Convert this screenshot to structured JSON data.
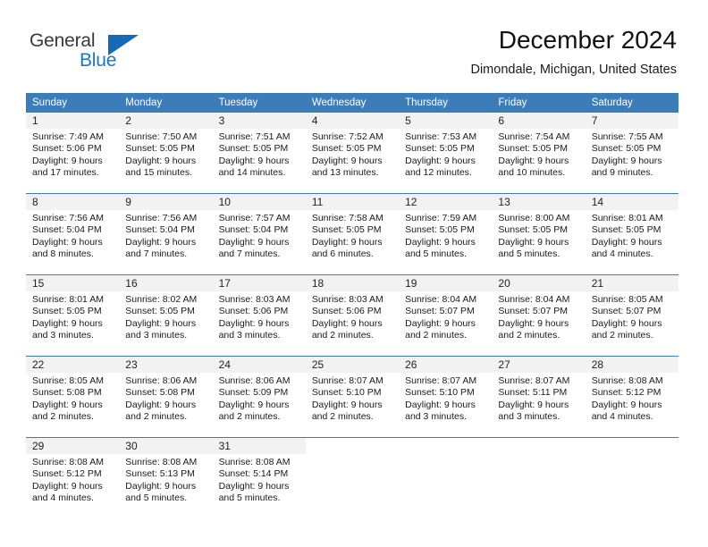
{
  "logo": {
    "primary_text": "General",
    "secondary_text": "Blue",
    "primary_color": "#3a3a3a",
    "secondary_color": "#1878c8",
    "accent_color": "#1669b5"
  },
  "header": {
    "title": "December 2024",
    "subtitle": "Dimondale, Michigan, United States"
  },
  "theme": {
    "header_row_bg": "#3c7cb9",
    "header_row_text": "#ffffff",
    "day_number_bg": "#f2f2f2",
    "week_divider": "#3c7cb9",
    "page_bg": "#ffffff"
  },
  "weekday_headers": [
    "Sunday",
    "Monday",
    "Tuesday",
    "Wednesday",
    "Thursday",
    "Friday",
    "Saturday"
  ],
  "weeks": [
    [
      {
        "day": "1",
        "sunrise": "Sunrise: 7:49 AM",
        "sunset": "Sunset: 5:06 PM",
        "daylight_line1": "Daylight: 9 hours",
        "daylight_line2": "and 17 minutes."
      },
      {
        "day": "2",
        "sunrise": "Sunrise: 7:50 AM",
        "sunset": "Sunset: 5:05 PM",
        "daylight_line1": "Daylight: 9 hours",
        "daylight_line2": "and 15 minutes."
      },
      {
        "day": "3",
        "sunrise": "Sunrise: 7:51 AM",
        "sunset": "Sunset: 5:05 PM",
        "daylight_line1": "Daylight: 9 hours",
        "daylight_line2": "and 14 minutes."
      },
      {
        "day": "4",
        "sunrise": "Sunrise: 7:52 AM",
        "sunset": "Sunset: 5:05 PM",
        "daylight_line1": "Daylight: 9 hours",
        "daylight_line2": "and 13 minutes."
      },
      {
        "day": "5",
        "sunrise": "Sunrise: 7:53 AM",
        "sunset": "Sunset: 5:05 PM",
        "daylight_line1": "Daylight: 9 hours",
        "daylight_line2": "and 12 minutes."
      },
      {
        "day": "6",
        "sunrise": "Sunrise: 7:54 AM",
        "sunset": "Sunset: 5:05 PM",
        "daylight_line1": "Daylight: 9 hours",
        "daylight_line2": "and 10 minutes."
      },
      {
        "day": "7",
        "sunrise": "Sunrise: 7:55 AM",
        "sunset": "Sunset: 5:05 PM",
        "daylight_line1": "Daylight: 9 hours",
        "daylight_line2": "and 9 minutes."
      }
    ],
    [
      {
        "day": "8",
        "sunrise": "Sunrise: 7:56 AM",
        "sunset": "Sunset: 5:04 PM",
        "daylight_line1": "Daylight: 9 hours",
        "daylight_line2": "and 8 minutes."
      },
      {
        "day": "9",
        "sunrise": "Sunrise: 7:56 AM",
        "sunset": "Sunset: 5:04 PM",
        "daylight_line1": "Daylight: 9 hours",
        "daylight_line2": "and 7 minutes."
      },
      {
        "day": "10",
        "sunrise": "Sunrise: 7:57 AM",
        "sunset": "Sunset: 5:04 PM",
        "daylight_line1": "Daylight: 9 hours",
        "daylight_line2": "and 7 minutes."
      },
      {
        "day": "11",
        "sunrise": "Sunrise: 7:58 AM",
        "sunset": "Sunset: 5:05 PM",
        "daylight_line1": "Daylight: 9 hours",
        "daylight_line2": "and 6 minutes."
      },
      {
        "day": "12",
        "sunrise": "Sunrise: 7:59 AM",
        "sunset": "Sunset: 5:05 PM",
        "daylight_line1": "Daylight: 9 hours",
        "daylight_line2": "and 5 minutes."
      },
      {
        "day": "13",
        "sunrise": "Sunrise: 8:00 AM",
        "sunset": "Sunset: 5:05 PM",
        "daylight_line1": "Daylight: 9 hours",
        "daylight_line2": "and 5 minutes."
      },
      {
        "day": "14",
        "sunrise": "Sunrise: 8:01 AM",
        "sunset": "Sunset: 5:05 PM",
        "daylight_line1": "Daylight: 9 hours",
        "daylight_line2": "and 4 minutes."
      }
    ],
    [
      {
        "day": "15",
        "sunrise": "Sunrise: 8:01 AM",
        "sunset": "Sunset: 5:05 PM",
        "daylight_line1": "Daylight: 9 hours",
        "daylight_line2": "and 3 minutes."
      },
      {
        "day": "16",
        "sunrise": "Sunrise: 8:02 AM",
        "sunset": "Sunset: 5:05 PM",
        "daylight_line1": "Daylight: 9 hours",
        "daylight_line2": "and 3 minutes."
      },
      {
        "day": "17",
        "sunrise": "Sunrise: 8:03 AM",
        "sunset": "Sunset: 5:06 PM",
        "daylight_line1": "Daylight: 9 hours",
        "daylight_line2": "and 3 minutes."
      },
      {
        "day": "18",
        "sunrise": "Sunrise: 8:03 AM",
        "sunset": "Sunset: 5:06 PM",
        "daylight_line1": "Daylight: 9 hours",
        "daylight_line2": "and 2 minutes."
      },
      {
        "day": "19",
        "sunrise": "Sunrise: 8:04 AM",
        "sunset": "Sunset: 5:07 PM",
        "daylight_line1": "Daylight: 9 hours",
        "daylight_line2": "and 2 minutes."
      },
      {
        "day": "20",
        "sunrise": "Sunrise: 8:04 AM",
        "sunset": "Sunset: 5:07 PM",
        "daylight_line1": "Daylight: 9 hours",
        "daylight_line2": "and 2 minutes."
      },
      {
        "day": "21",
        "sunrise": "Sunrise: 8:05 AM",
        "sunset": "Sunset: 5:07 PM",
        "daylight_line1": "Daylight: 9 hours",
        "daylight_line2": "and 2 minutes."
      }
    ],
    [
      {
        "day": "22",
        "sunrise": "Sunrise: 8:05 AM",
        "sunset": "Sunset: 5:08 PM",
        "daylight_line1": "Daylight: 9 hours",
        "daylight_line2": "and 2 minutes."
      },
      {
        "day": "23",
        "sunrise": "Sunrise: 8:06 AM",
        "sunset": "Sunset: 5:08 PM",
        "daylight_line1": "Daylight: 9 hours",
        "daylight_line2": "and 2 minutes."
      },
      {
        "day": "24",
        "sunrise": "Sunrise: 8:06 AM",
        "sunset": "Sunset: 5:09 PM",
        "daylight_line1": "Daylight: 9 hours",
        "daylight_line2": "and 2 minutes."
      },
      {
        "day": "25",
        "sunrise": "Sunrise: 8:07 AM",
        "sunset": "Sunset: 5:10 PM",
        "daylight_line1": "Daylight: 9 hours",
        "daylight_line2": "and 2 minutes."
      },
      {
        "day": "26",
        "sunrise": "Sunrise: 8:07 AM",
        "sunset": "Sunset: 5:10 PM",
        "daylight_line1": "Daylight: 9 hours",
        "daylight_line2": "and 3 minutes."
      },
      {
        "day": "27",
        "sunrise": "Sunrise: 8:07 AM",
        "sunset": "Sunset: 5:11 PM",
        "daylight_line1": "Daylight: 9 hours",
        "daylight_line2": "and 3 minutes."
      },
      {
        "day": "28",
        "sunrise": "Sunrise: 8:08 AM",
        "sunset": "Sunset: 5:12 PM",
        "daylight_line1": "Daylight: 9 hours",
        "daylight_line2": "and 4 minutes."
      }
    ],
    [
      {
        "day": "29",
        "sunrise": "Sunrise: 8:08 AM",
        "sunset": "Sunset: 5:12 PM",
        "daylight_line1": "Daylight: 9 hours",
        "daylight_line2": "and 4 minutes."
      },
      {
        "day": "30",
        "sunrise": "Sunrise: 8:08 AM",
        "sunset": "Sunset: 5:13 PM",
        "daylight_line1": "Daylight: 9 hours",
        "daylight_line2": "and 5 minutes."
      },
      {
        "day": "31",
        "sunrise": "Sunrise: 8:08 AM",
        "sunset": "Sunset: 5:14 PM",
        "daylight_line1": "Daylight: 9 hours",
        "daylight_line2": "and 5 minutes."
      },
      {
        "day": "",
        "sunrise": "",
        "sunset": "",
        "daylight_line1": "",
        "daylight_line2": ""
      },
      {
        "day": "",
        "sunrise": "",
        "sunset": "",
        "daylight_line1": "",
        "daylight_line2": ""
      },
      {
        "day": "",
        "sunrise": "",
        "sunset": "",
        "daylight_line1": "",
        "daylight_line2": ""
      },
      {
        "day": "",
        "sunrise": "",
        "sunset": "",
        "daylight_line1": "",
        "daylight_line2": ""
      }
    ]
  ]
}
